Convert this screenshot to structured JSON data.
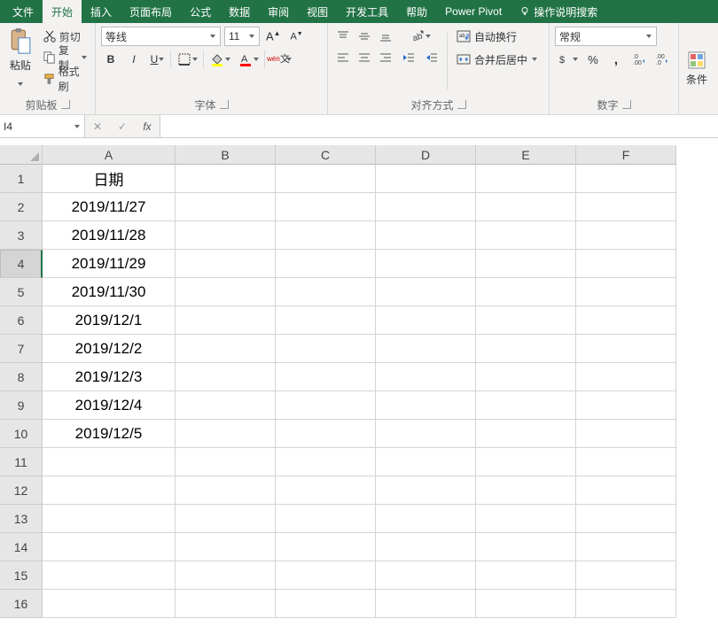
{
  "tabs": {
    "file": "文件",
    "home": "开始",
    "insert": "插入",
    "layout": "页面布局",
    "formulas": "公式",
    "data": "数据",
    "review": "审阅",
    "view": "视图",
    "dev": "开发工具",
    "help": "帮助",
    "powerpivot": "Power Pivot",
    "tellme": "操作说明搜索"
  },
  "ribbon": {
    "clipboard": {
      "paste": "粘贴",
      "cut": "剪切",
      "copy": "复制",
      "painter": "格式刷",
      "label": "剪贴板"
    },
    "font": {
      "name": "等线",
      "size": "11",
      "label": "字体"
    },
    "align": {
      "wrap": "自动换行",
      "merge": "合并后居中",
      "label": "对齐方式"
    },
    "number": {
      "format": "常规",
      "label": "数字"
    },
    "styles": {
      "cond": "条件"
    }
  },
  "formulaBar": {
    "nameBox": "I4",
    "fx": "fx",
    "value": ""
  },
  "columns": [
    "A",
    "B",
    "C",
    "D",
    "E",
    "F"
  ],
  "rows": [
    1,
    2,
    3,
    4,
    5,
    6,
    7,
    8,
    9,
    10,
    11,
    12,
    13,
    14,
    15,
    16
  ],
  "activeRow": 4,
  "sheet": {
    "A1": "日期",
    "A": [
      "2019/11/27",
      "2019/11/28",
      "2019/11/29",
      "2019/11/30",
      "2019/12/1",
      "2019/12/2",
      "2019/12/3",
      "2019/12/4",
      "2019/12/5"
    ]
  }
}
